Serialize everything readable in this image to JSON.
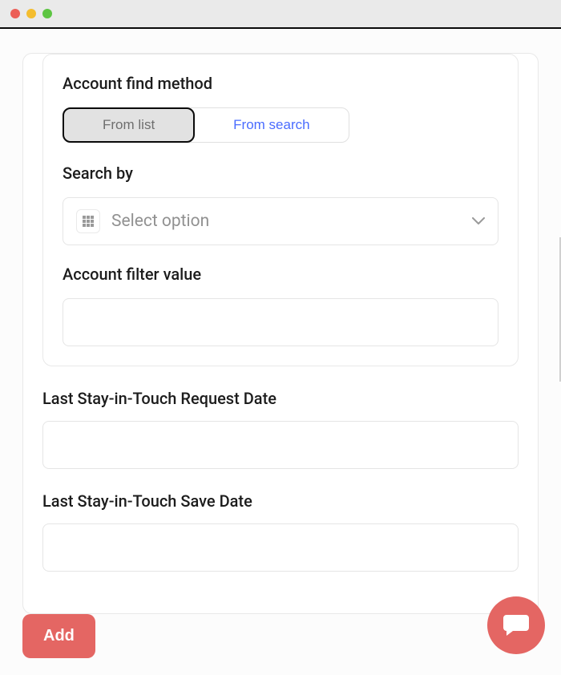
{
  "card": {
    "accountFindMethod": {
      "label": "Account find method",
      "options": {
        "fromList": "From list",
        "fromSearch": "From search"
      }
    },
    "searchBy": {
      "label": "Search by",
      "placeholder": "Select option"
    },
    "filterValue": {
      "label": "Account filter value",
      "value": ""
    }
  },
  "outerFields": {
    "lastRequest": {
      "label": "Last Stay-in-Touch Request Date",
      "value": ""
    },
    "lastSave": {
      "label": "Last Stay-in-Touch Save Date",
      "value": ""
    }
  },
  "actions": {
    "add": "Add"
  }
}
